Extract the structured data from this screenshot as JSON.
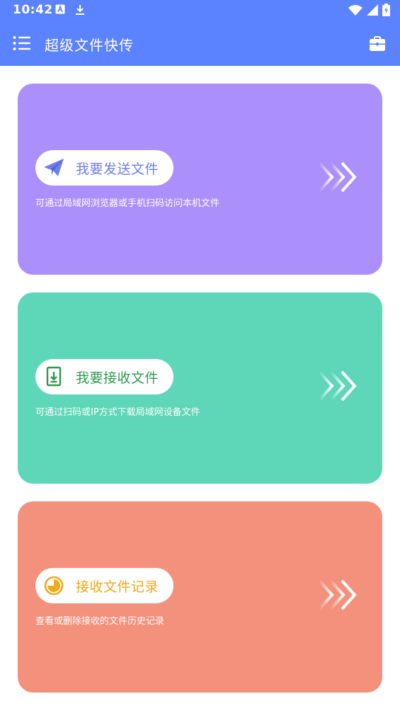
{
  "status_bar": {
    "time": "10:42",
    "left_icons": [
      "a-notification-icon",
      "download-icon"
    ],
    "right_icons": [
      "wifi-icon",
      "cell-signal-icon",
      "battery-charging-icon"
    ]
  },
  "app_bar": {
    "title": "超级文件快传",
    "menu_icon": "list-menu-icon",
    "action_icon": "toolbox-icon",
    "color": "#5b82ff"
  },
  "cards": {
    "send": {
      "label": "我要发送文件",
      "description": "可通过局域网浏览器或手机扫码访问本机文件",
      "icon": "paper-plane-icon",
      "background": "#ab8ffb",
      "label_color": "#6f7fe9"
    },
    "receive": {
      "label": "我要接收文件",
      "description": "可通过扫码或IP方式下载局域网设备文件",
      "icon": "file-download-icon",
      "background": "#5ed6b8",
      "label_color": "#2f9a4f"
    },
    "history": {
      "label": "接收文件记录",
      "description": "查看或删除接收的文件历史记录",
      "icon": "pie-chart-icon",
      "background": "#f3917d",
      "label_color": "#f0a81c"
    }
  }
}
